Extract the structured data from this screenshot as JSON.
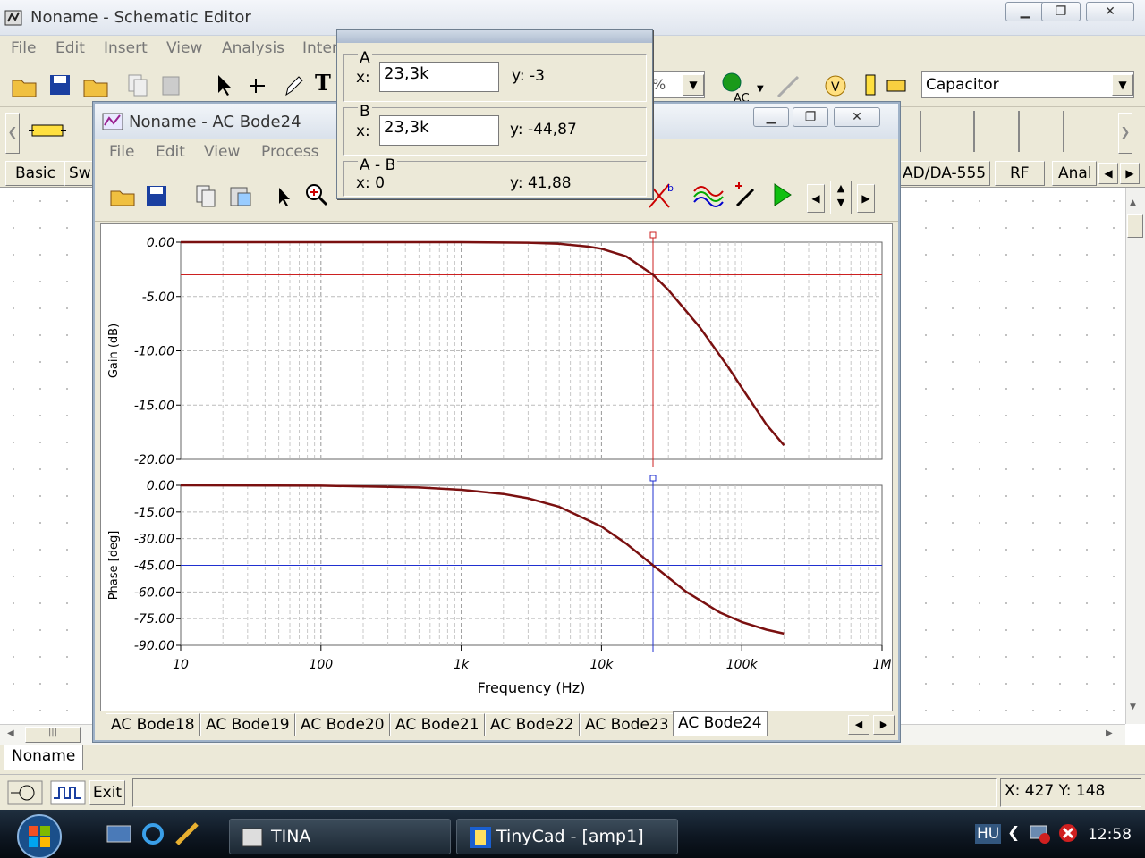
{
  "main_window": {
    "title": "Noname - Schematic Editor",
    "menu": [
      "File",
      "Edit",
      "Insert",
      "View",
      "Analysis",
      "Inter"
    ],
    "component_dropdown": "Capacitor",
    "percent_dropdown": "%",
    "component_tabs": [
      "Basic",
      "Sw",
      "AD/DA-555",
      "RF",
      "Anal"
    ],
    "doc_tab": "Noname",
    "exit_label": "Exit",
    "coords": "X: 427  Y: 148"
  },
  "bode_window": {
    "title": "Noname - AC Bode24",
    "menu": [
      "File",
      "Edit",
      "View",
      "Process"
    ],
    "tabs": [
      "AC Bode18",
      "AC Bode19",
      "AC Bode20",
      "AC Bode21",
      "AC Bode22",
      "AC Bode23",
      "AC Bode24"
    ],
    "active_tab": "AC Bode24"
  },
  "cursor_dialog": {
    "a_label": "A",
    "a_x_label": "x:",
    "a_x": "23,3k",
    "a_y": "y: -3",
    "b_label": "B",
    "b_x_label": "x:",
    "b_x": "23,3k",
    "b_y": "y: -44,87",
    "ab_label": "A - B",
    "ab_x": "x:  0",
    "ab_y": "y: 41,88"
  },
  "taskbar": {
    "buttons": [
      "TINA",
      "TinyCad - [amp1]"
    ],
    "lang": "HU",
    "clock": "12:58"
  },
  "chart_data": [
    {
      "type": "line",
      "ylabel": "Gain (dB)",
      "xscale": "log",
      "xlim": [
        10,
        1000000
      ],
      "ylim": [
        -20,
        0
      ],
      "yticks": [
        "0.00",
        "-5.00",
        "-10.00",
        "-15.00",
        "-20.00"
      ],
      "grid": true,
      "series": [
        {
          "color": "#7a1010",
          "x": [
            10,
            100,
            1000,
            3000,
            5000,
            8000,
            10000,
            15000,
            23300,
            30000,
            50000,
            80000,
            100000,
            150000,
            200000
          ],
          "y": [
            0,
            0,
            0,
            -0.05,
            -0.15,
            -0.4,
            -0.6,
            -1.3,
            -3,
            -4.4,
            -7.8,
            -11.5,
            -13.4,
            -16.8,
            -18.7
          ]
        }
      ],
      "cursor": {
        "x": 23300,
        "y": -3,
        "color": "#cc2020"
      }
    },
    {
      "type": "line",
      "ylabel": "Phase [deg]",
      "xlabel": "Frequency (Hz)",
      "xscale": "log",
      "xlim": [
        10,
        1000000
      ],
      "ylim": [
        -90,
        0
      ],
      "yticks": [
        "0.00",
        "-15.00",
        "-30.00",
        "-45.00",
        "-60.00",
        "-75.00",
        "-90.00"
      ],
      "xticks": [
        "10",
        "100",
        "1k",
        "10k",
        "100k",
        "1M"
      ],
      "grid": true,
      "series": [
        {
          "color": "#7a1010",
          "x": [
            10,
            100,
            500,
            1000,
            2000,
            3000,
            5000,
            10000,
            15000,
            23300,
            40000,
            70000,
            100000,
            150000,
            200000
          ],
          "y": [
            0,
            -0.2,
            -1.2,
            -2.5,
            -4.9,
            -7.3,
            -12.1,
            -23.2,
            -32.8,
            -45,
            -59.8,
            -71.6,
            -76.9,
            -81.2,
            -83.4
          ]
        }
      ],
      "cursor": {
        "x": 23300,
        "y": -45,
        "color": "#2030d0"
      }
    }
  ]
}
